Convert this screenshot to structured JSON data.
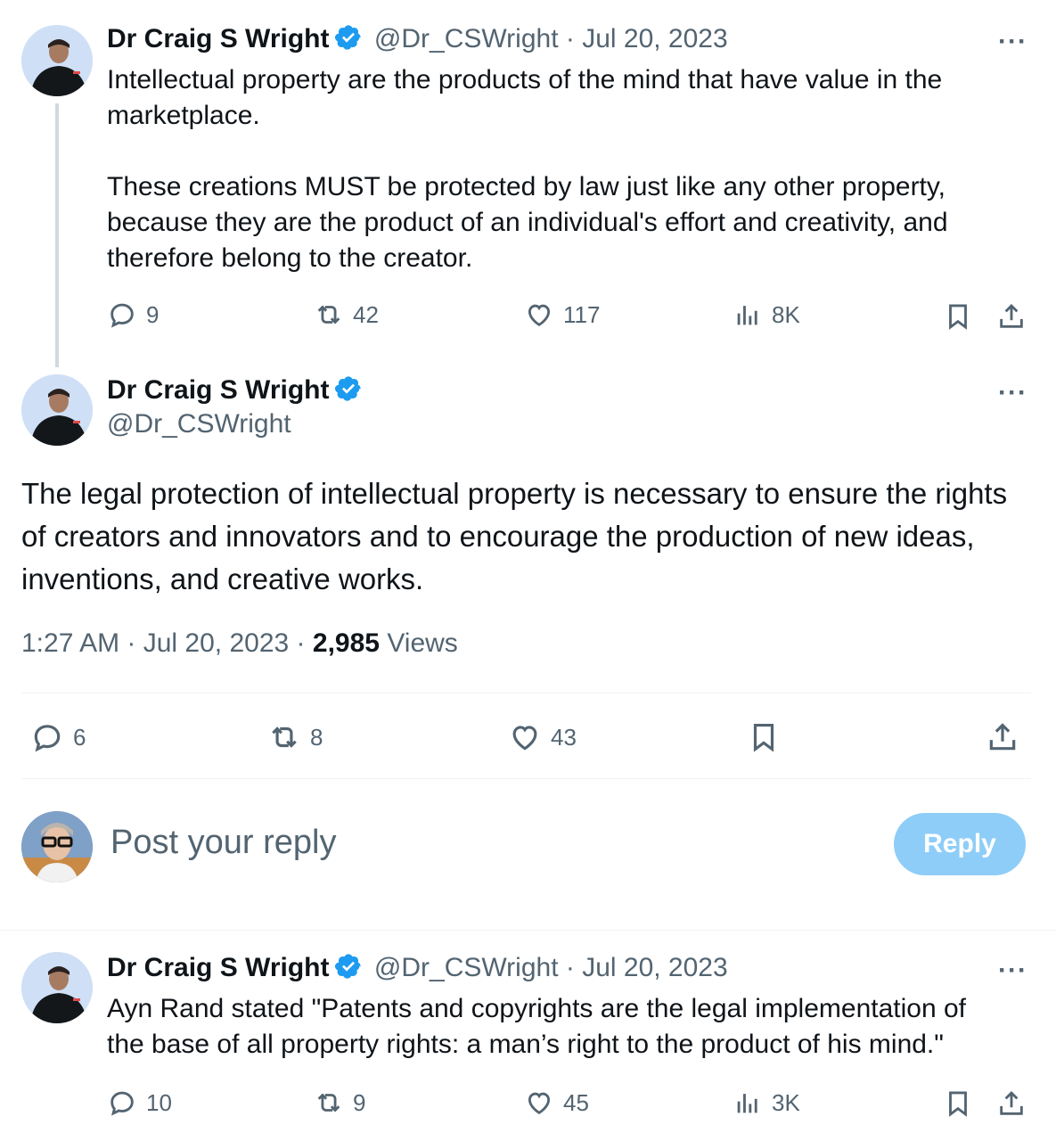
{
  "tweet1": {
    "name": "Dr Craig S Wright",
    "handle": "@Dr_CSWright",
    "date": "Jul 20, 2023",
    "text": "Intellectual property are the products of the mind that have value in the marketplace.\n\nThese creations MUST be protected by law just like any other property, because they are the product of an individual's effort and creativity, and therefore belong to the creator.",
    "replies": "9",
    "reposts": "42",
    "likes": "117",
    "views": "8K"
  },
  "tweet2": {
    "name": "Dr Craig S Wright",
    "handle": "@Dr_CSWright",
    "text": "The legal protection of intellectual property is necessary to ensure the rights of creators and innovators and to encourage the production of new ideas, inventions, and creative works.",
    "time": "1:27 AM",
    "date": "Jul 20, 2023",
    "views_count": "2,985",
    "views_label": "Views",
    "replies": "6",
    "reposts": "8",
    "likes": "43"
  },
  "compose": {
    "placeholder": "Post your reply",
    "button": "Reply"
  },
  "tweet3": {
    "name": "Dr Craig S Wright",
    "handle": "@Dr_CSWright",
    "date": "Jul 20, 2023",
    "text": "Ayn Rand stated \"Patents and copyrights are the legal implementation of the base of all property rights: a man’s right to the product of his mind.\"",
    "replies": "10",
    "reposts": "9",
    "likes": "45",
    "views": "3K"
  },
  "icons": {
    "verified": "verified-badge-icon",
    "reply": "reply-icon",
    "repost": "repost-icon",
    "like": "heart-icon",
    "views": "views-chart-icon",
    "bookmark": "bookmark-icon",
    "share": "share-icon",
    "more": "more-icon"
  },
  "colors": {
    "verified": "#1d9bf0",
    "muted": "#536471",
    "reply_button_disabled": "#8ecdf8"
  }
}
